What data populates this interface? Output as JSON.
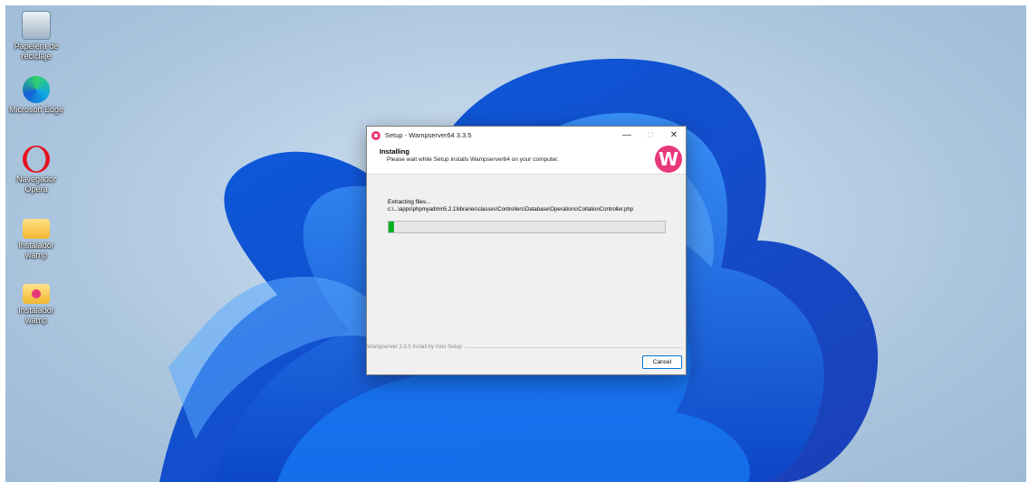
{
  "desktop": {
    "icons": [
      {
        "label": "Papelera de reciclaje",
        "icon": "recycle-bin-icon"
      },
      {
        "label": "Microsoft Edge",
        "icon": "edge-icon"
      },
      {
        "label": "Navegador Opera",
        "icon": "opera-icon"
      },
      {
        "label": "Instalador wamp",
        "icon": "folder-icon"
      },
      {
        "label": "Instalador wamp",
        "icon": "folder-wamp-icon"
      }
    ]
  },
  "installer": {
    "window_title": "Setup - Wampserver64 3.3.5",
    "heading": "Installing",
    "subheading": "Please wait while Setup installs Wampserver64 on your computer.",
    "status_text": "Extracting files...",
    "current_file": "c:\\...\\apps\\phpmyadmin5.2.1\\libraries\\classes\\Controllers\\Database\\Operations\\CollationController.php",
    "progress_percent": 2,
    "footer_brand": "Wampserver 3.3.5 Install by Inno Setup",
    "cancel_label": "Cancel",
    "logo_letter": "W",
    "accent_color": "#e8387c",
    "progress_color": "#06b025"
  }
}
